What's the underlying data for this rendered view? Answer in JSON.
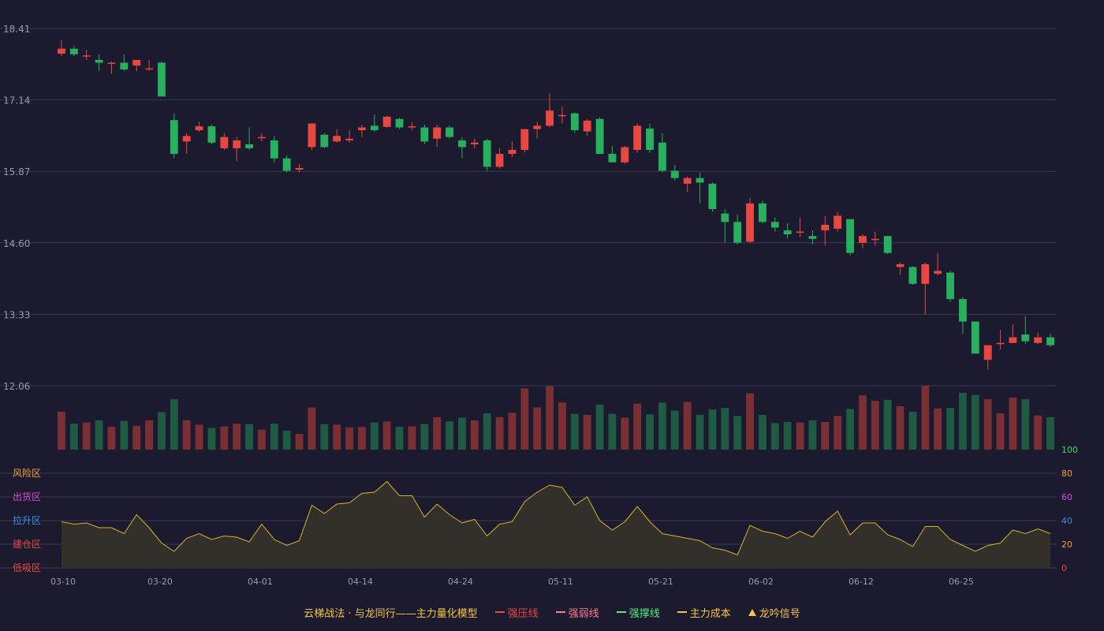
{
  "colors": {
    "background": "#1b1a2e",
    "grid": "#3a3a52",
    "axis_text": "#9a9aa8",
    "up": "#e8483f",
    "down": "#27b15f",
    "volume_up": "#7a2f35",
    "volume_down": "#1f5a42",
    "oscillator_line": "#d4b42a",
    "oscillator_fill": "#35302a"
  },
  "chart_data": [
    {
      "type": "candlestick",
      "y_ticks": [
        "18.41",
        "17.14",
        "15.87",
        "14.60",
        "13.33",
        "12.06"
      ],
      "ylim": [
        12.06,
        18.41
      ],
      "grid": true,
      "x_ticks": [
        "03-10",
        "03-20",
        "04-01",
        "04-14",
        "04-24",
        "05-11",
        "05-21",
        "06-02",
        "06-12",
        "06-25"
      ],
      "x_tick_index": [
        0,
        8,
        16,
        24,
        32,
        40,
        48,
        56,
        64,
        72
      ],
      "ohlc": [
        [
          17.96,
          18.05,
          18.2,
          17.92
        ],
        [
          18.05,
          17.95,
          18.1,
          17.92
        ],
        [
          17.93,
          17.93,
          18.03,
          17.85
        ],
        [
          17.85,
          17.8,
          17.95,
          17.65
        ],
        [
          17.8,
          17.8,
          17.82,
          17.6
        ],
        [
          17.8,
          17.68,
          17.95,
          17.65
        ],
        [
          17.75,
          17.85,
          17.85,
          17.65
        ],
        [
          17.7,
          17.7,
          17.85,
          17.65
        ],
        [
          17.8,
          17.2,
          17.82,
          17.2
        ],
        [
          16.78,
          16.18,
          16.9,
          16.1
        ],
        [
          16.4,
          16.5,
          16.55,
          16.18
        ],
        [
          16.6,
          16.67,
          16.75,
          16.57
        ],
        [
          16.67,
          16.38,
          16.7,
          16.35
        ],
        [
          16.28,
          16.48,
          16.55,
          16.25
        ],
        [
          16.28,
          16.42,
          16.48,
          16.05
        ],
        [
          16.35,
          16.28,
          16.65,
          16.25
        ],
        [
          16.48,
          16.48,
          16.55,
          16.4
        ],
        [
          16.42,
          16.1,
          16.5,
          16.02
        ],
        [
          16.1,
          15.88,
          16.15,
          15.85
        ],
        [
          15.9,
          15.93,
          16.0,
          15.85
        ],
        [
          16.3,
          16.72,
          16.72,
          16.25
        ],
        [
          16.52,
          16.3,
          16.55,
          16.28
        ],
        [
          16.4,
          16.5,
          16.62,
          16.38
        ],
        [
          16.42,
          16.45,
          16.6,
          16.38
        ],
        [
          16.6,
          16.65,
          16.7,
          16.48
        ],
        [
          16.68,
          16.6,
          16.88,
          16.57
        ],
        [
          16.66,
          16.84,
          16.86,
          16.64
        ],
        [
          16.8,
          16.65,
          16.82,
          16.62
        ],
        [
          16.65,
          16.67,
          16.75,
          16.6
        ],
        [
          16.65,
          16.4,
          16.7,
          16.35
        ],
        [
          16.45,
          16.65,
          16.7,
          16.3
        ],
        [
          16.65,
          16.48,
          16.68,
          16.45
        ],
        [
          16.42,
          16.3,
          16.48,
          16.1
        ],
        [
          16.35,
          16.38,
          16.45,
          16.28
        ],
        [
          16.42,
          15.95,
          16.45,
          15.88
        ],
        [
          15.95,
          16.18,
          16.28,
          15.92
        ],
        [
          16.18,
          16.25,
          16.4,
          16.12
        ],
        [
          16.25,
          16.62,
          16.62,
          16.2
        ],
        [
          16.62,
          16.68,
          16.75,
          16.45
        ],
        [
          16.68,
          16.95,
          17.26,
          16.65
        ],
        [
          16.85,
          16.87,
          17.02,
          16.72
        ],
        [
          16.9,
          16.6,
          16.92,
          16.55
        ],
        [
          16.58,
          16.77,
          16.8,
          16.5
        ],
        [
          16.8,
          16.18,
          16.83,
          16.18
        ],
        [
          16.18,
          16.03,
          16.32,
          16.03
        ],
        [
          16.03,
          16.3,
          16.32,
          16.0
        ],
        [
          16.25,
          16.68,
          16.72,
          16.2
        ],
        [
          16.63,
          16.25,
          16.72,
          16.2
        ],
        [
          16.38,
          15.88,
          16.55,
          15.85
        ],
        [
          15.88,
          15.75,
          15.98,
          15.7
        ],
        [
          15.65,
          15.75,
          15.78,
          15.5
        ],
        [
          15.75,
          15.67,
          15.85,
          15.3
        ],
        [
          15.65,
          15.2,
          15.67,
          15.15
        ],
        [
          15.12,
          14.97,
          15.2,
          14.6
        ],
        [
          14.97,
          14.6,
          15.1,
          14.57
        ],
        [
          14.62,
          15.3,
          15.4,
          14.6
        ],
        [
          15.3,
          14.97,
          15.35,
          14.95
        ],
        [
          14.97,
          14.87,
          15.05,
          14.8
        ],
        [
          14.82,
          14.75,
          14.95,
          14.68
        ],
        [
          14.8,
          14.8,
          15.05,
          14.7
        ],
        [
          14.72,
          14.67,
          14.82,
          14.57
        ],
        [
          14.82,
          14.92,
          15.07,
          14.55
        ],
        [
          14.85,
          15.08,
          15.15,
          14.8
        ],
        [
          15.02,
          14.42,
          15.02,
          14.38
        ],
        [
          14.6,
          14.72,
          14.75,
          14.5
        ],
        [
          14.65,
          14.67,
          14.8,
          14.55
        ],
        [
          14.72,
          14.42,
          14.72,
          14.4
        ],
        [
          14.17,
          14.22,
          14.25,
          14.03
        ],
        [
          14.17,
          13.87,
          14.18,
          13.85
        ],
        [
          13.87,
          14.22,
          14.25,
          13.33
        ],
        [
          14.05,
          14.1,
          14.42,
          14.02
        ],
        [
          14.07,
          13.6,
          14.1,
          13.55
        ],
        [
          13.6,
          13.2,
          13.63,
          12.98
        ],
        [
          13.2,
          12.63,
          13.2,
          12.63
        ],
        [
          12.52,
          12.78,
          12.78,
          12.35
        ],
        [
          12.82,
          12.82,
          13.05,
          12.7
        ],
        [
          12.82,
          12.92,
          13.15,
          12.82
        ],
        [
          12.97,
          12.85,
          13.3,
          12.8
        ],
        [
          12.82,
          12.92,
          13.0,
          12.8
        ],
        [
          12.92,
          12.78,
          12.98,
          12.75
        ]
      ]
    },
    {
      "type": "bar",
      "series": [
        {
          "values": [
            0.7,
            0.48,
            0.5,
            0.54,
            0.42,
            0.53,
            0.44,
            0.54,
            0.69,
            0.93,
            0.54,
            0.46,
            0.4,
            0.43,
            0.48,
            0.47,
            0.37,
            0.48,
            0.35,
            0.29,
            0.78,
            0.47,
            0.46,
            0.41,
            0.42,
            0.5,
            0.52,
            0.42,
            0.43,
            0.47,
            0.6,
            0.52,
            0.59,
            0.54,
            0.67,
            0.6,
            0.68,
            1.13,
            0.78,
            1.17,
            0.87,
            0.66,
            0.64,
            0.83,
            0.66,
            0.59,
            0.85,
            0.65,
            0.87,
            0.72,
            0.88,
            0.64,
            0.74,
            0.77,
            0.62,
            1.04,
            0.64,
            0.49,
            0.51,
            0.5,
            0.54,
            0.51,
            0.62,
            0.75,
            1.0,
            0.9,
            0.92,
            0.8,
            0.7,
            1.18,
            0.76,
            0.77,
            1.05,
            1.01,
            0.93,
            0.67,
            0.96,
            0.93,
            0.63,
            0.6
          ]
        }
      ],
      "ylim": [
        0,
        1.18
      ]
    },
    {
      "type": "area",
      "left_labels": [
        "风险区",
        "出货区",
        "拉升区",
        "建仓区",
        "低吸区"
      ],
      "left_label_colors": [
        "#e8a23a",
        "#d648c8",
        "#3f8ae8",
        "#e8483f",
        "#e8483f"
      ],
      "y_ticks": [
        "100",
        "80",
        "60",
        "40",
        "20",
        "0"
      ],
      "y_tick_colors": [
        "#2ee05a",
        "#f5a020",
        "#e040e0",
        "#3f8ae8",
        "#f5a020",
        "#e8483f"
      ],
      "ylim": [
        0,
        100
      ],
      "grid": true,
      "series": [
        {
          "values": [
            39,
            37,
            38,
            34,
            34,
            29,
            45,
            34,
            21,
            14,
            25,
            29,
            24,
            27,
            26,
            22,
            37,
            24,
            19,
            23,
            53,
            46,
            54,
            55,
            63,
            64,
            73,
            61,
            61,
            43,
            54,
            45,
            38,
            41,
            27,
            37,
            39,
            56,
            64,
            70,
            68,
            53,
            60,
            40,
            32,
            39,
            52,
            39,
            29,
            27,
            25,
            23,
            17,
            15,
            11,
            36,
            31,
            29,
            25,
            31,
            26,
            39,
            48,
            28,
            38,
            38,
            28,
            24,
            18,
            35,
            35,
            24,
            19,
            14,
            19,
            21,
            32,
            29,
            33,
            29
          ]
        }
      ]
    }
  ],
  "legend": {
    "title": "云梯战法 · 与龙同行——主力量化模型",
    "items": [
      {
        "label": "强压线",
        "color": "#e8483f",
        "style": "solid"
      },
      {
        "label": "强弱线",
        "color": "#ff7a8a",
        "style": "dashed"
      },
      {
        "label": "强撑线",
        "color": "#4df07a",
        "style": "solid"
      },
      {
        "label": "主力成本",
        "color": "#f5c542",
        "style": "dashed"
      },
      {
        "label": "龙吟信号",
        "color": "#f5c542",
        "style": "triangle"
      }
    ],
    "title_color": "#f5c542"
  }
}
